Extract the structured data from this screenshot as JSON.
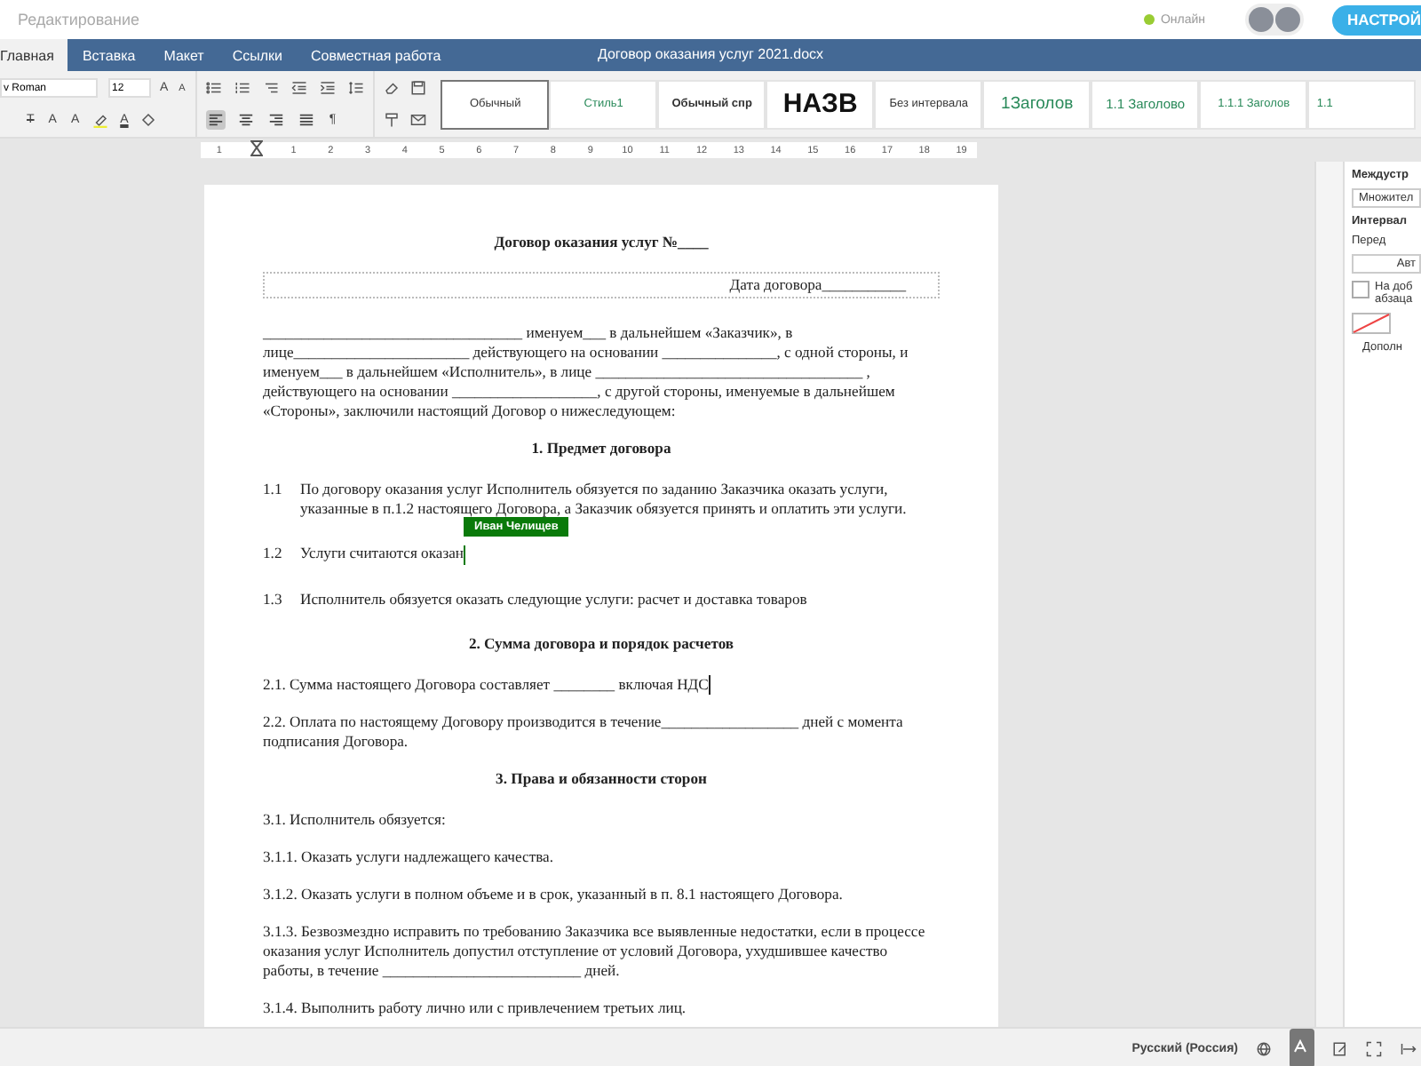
{
  "top_bar": {
    "mode": "Редактирование",
    "presence": "Онлайн",
    "settings_button": "НАСТРОЙ"
  },
  "tabs": [
    {
      "label": "Главная",
      "selected": true
    },
    {
      "label": "Вставка",
      "selected": false
    },
    {
      "label": "Макет",
      "selected": false
    },
    {
      "label": "Ссылки",
      "selected": false
    },
    {
      "label": "Совместная работа",
      "selected": false
    }
  ],
  "document_title": "Договор оказания услуг 2021.docx",
  "toolbar": {
    "font_name": "v Roman",
    "font_size": "12",
    "grow": "A",
    "shrink": "A",
    "strike": "T",
    "superscript": "A",
    "subscript": "A",
    "font_color": "A",
    "pilcrow": "¶",
    "alignments": [
      {
        "selected": true
      },
      {
        "selected": false
      },
      {
        "selected": false
      },
      {
        "selected": false
      }
    ]
  },
  "styles": [
    {
      "label": "Обычный",
      "kind": "normal",
      "selected": true
    },
    {
      "label": "Стиль1",
      "kind": "accent",
      "selected": false
    },
    {
      "label": "Обычный спр",
      "kind": "bold",
      "selected": false
    },
    {
      "label": "НАЗВ",
      "kind": "title",
      "selected": false
    },
    {
      "label": "Без интервала",
      "kind": "normal",
      "selected": false
    },
    {
      "label": "1Заголов",
      "kind": "heading1",
      "selected": false
    },
    {
      "label": "1.1 Заголово",
      "kind": "heading2",
      "selected": false
    },
    {
      "label": "1.1.1 Заголов",
      "kind": "heading3",
      "selected": false
    },
    {
      "label": "1.1",
      "kind": "heading3",
      "selected": false
    }
  ],
  "ruler": [
    "1",
    "1",
    "2",
    "3",
    "4",
    "5",
    "6",
    "7",
    "8",
    "9",
    "10",
    "11",
    "12",
    "13",
    "14",
    "15",
    "16",
    "17",
    "18",
    "19"
  ],
  "document": [
    {
      "kind": "title",
      "text": "Договор оказания услуг №____"
    },
    {
      "kind": "field_box",
      "text": "Дата договора___________"
    },
    {
      "kind": "para",
      "text": "__________________________________ именуем___ в дальнейшем «Заказчик», в лице_______________________ действующего на основании _______________, с одной стороны, и именуем___ в дальнейшем «Исполнитель», в лице ___________________________________ , действующего на основании ___________________, с другой стороны, именуемые в дальнейшем «Стороны», заключили настоящий Договор о нижеследующем:"
    },
    {
      "kind": "heading",
      "text": "1. Предмет договора"
    },
    {
      "kind": "numbered",
      "number": "1.1",
      "text": "По договору оказания услуг Исполнитель обязуется по заданию Заказчика оказать услуги, указанные в п.1.2 настоящего Договора, а Заказчик обязуется принять и оплатить эти услуги."
    },
    {
      "kind": "numbered",
      "number": "1.2",
      "text": "Услуги считаются оказан",
      "collaborator": "Иван Челищев"
    },
    {
      "kind": "numbered",
      "number": "1.3",
      "text": "Исполнитель обязуется оказать следующие услуги: расчет и доставка товаров"
    },
    {
      "kind": "heading",
      "text": "2. Сумма договора и порядок расчетов"
    },
    {
      "kind": "para",
      "text": "2.1. Сумма настоящего Договора составляет ________  включая НДС",
      "cursor": true
    },
    {
      "kind": "para",
      "text": "2.2. Оплата по настоящему Договору производится в течение__________________ дней с момента подписания Договора."
    },
    {
      "kind": "heading",
      "text": "3. Права и обязанности сторон"
    },
    {
      "kind": "para",
      "text": "3.1. Исполнитель обязуется:"
    },
    {
      "kind": "para",
      "text": "3.1.1. Оказать услуги надлежащего качества."
    },
    {
      "kind": "para",
      "text": "3.1.2. Оказать услуги в полном объеме и в срок, указанный в п. 8.1 настоящего Договора."
    },
    {
      "kind": "para",
      "text": "3.1.3. Безвозмездно исправить по требованию Заказчика все выявленные недостатки, если в процессе оказания услуг Исполнитель допустил отступление от условий Договора, ухудшившее качество работы, в течение __________________________ дней."
    },
    {
      "kind": "para",
      "text": "3.1.4. Выполнить работу лично или с привлечением третьих лиц."
    }
  ],
  "right_panel": {
    "line_spacing_label": "Междустр",
    "line_spacing_value": "Множител",
    "spacing_label": "Интервал",
    "before_label": "Перед",
    "before_value": "Авт",
    "no_add_checked": false,
    "no_add_label": "На доб",
    "no_add_label_2": "абзаца",
    "advanced": "Дополн"
  },
  "status_bar": {
    "language": "Русский (Россия)",
    "spellcheck_on": true
  }
}
